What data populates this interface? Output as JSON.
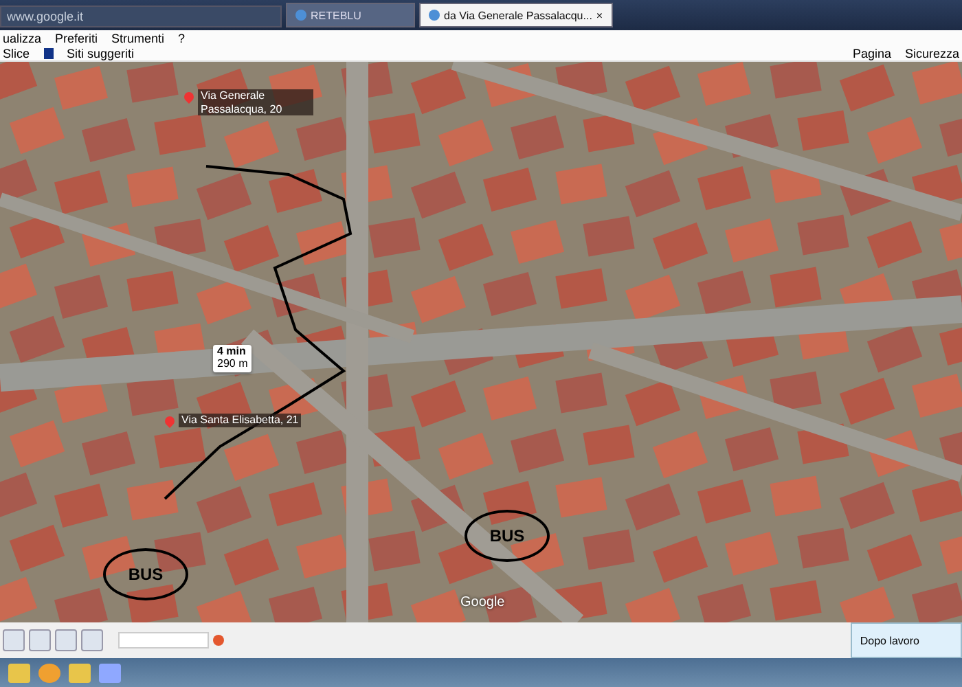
{
  "browser": {
    "address": "www.google.it",
    "tabs": [
      {
        "label": "RETEBLU",
        "selected": false
      },
      {
        "label": "da Via Generale Passalacqu...",
        "selected": true,
        "close": "×"
      }
    ]
  },
  "menu": [
    "ualizza",
    "Preferiti",
    "Strumenti",
    "?"
  ],
  "favorites": [
    "Slice",
    "Siti suggeriti"
  ],
  "command_bar": [
    "Pagina",
    "Sicurezza"
  ],
  "map": {
    "places": [
      {
        "kind": "pin",
        "label": "Via Generale Passalacqua, 20"
      },
      {
        "kind": "pin",
        "label": "Via Santa Elisabetta, 21"
      }
    ],
    "route": {
      "duration": "4 min",
      "distance": "290 m"
    },
    "bus_stops": [
      "BUS",
      "BUS"
    ],
    "attribution": "Google"
  },
  "notification": "Dopo lavoro"
}
